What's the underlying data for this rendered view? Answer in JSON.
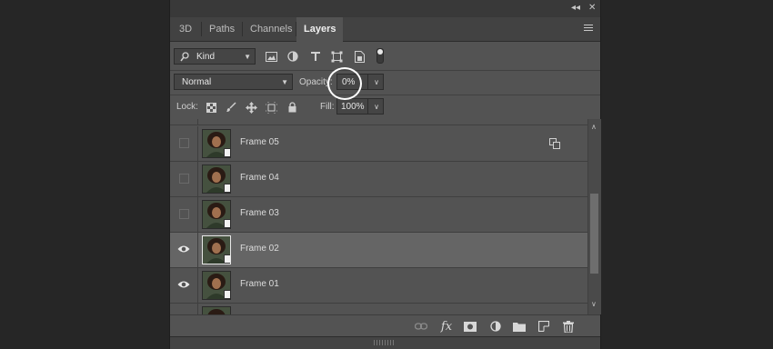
{
  "tabs": [
    {
      "label": "3D"
    },
    {
      "label": "Paths"
    },
    {
      "label": "Channels"
    },
    {
      "label": "Layers"
    }
  ],
  "filter": {
    "kind_label": "Kind"
  },
  "blend": {
    "mode": "Normal",
    "opacity_label": "Opacity:",
    "opacity_value": "0%"
  },
  "lock": {
    "label": "Lock:",
    "fill_label": "Fill:",
    "fill_value": "100%"
  },
  "layers": [
    {
      "name": "Frame 05",
      "visible": false,
      "selected": false
    },
    {
      "name": "Frame 04",
      "visible": false,
      "selected": false
    },
    {
      "name": "Frame 03",
      "visible": false,
      "selected": false
    },
    {
      "name": "Frame 02",
      "visible": true,
      "selected": true
    },
    {
      "name": "Frame 01",
      "visible": true,
      "selected": false
    }
  ],
  "footer_icons": [
    "link-icon",
    "fx-icon",
    "mask-icon",
    "adjustment-icon",
    "folder-icon",
    "new-layer-icon",
    "trash-icon"
  ],
  "colors": {
    "panel": "#535353",
    "selected_row": "#656565",
    "background": "#262626",
    "highlight": "#ffffff"
  }
}
